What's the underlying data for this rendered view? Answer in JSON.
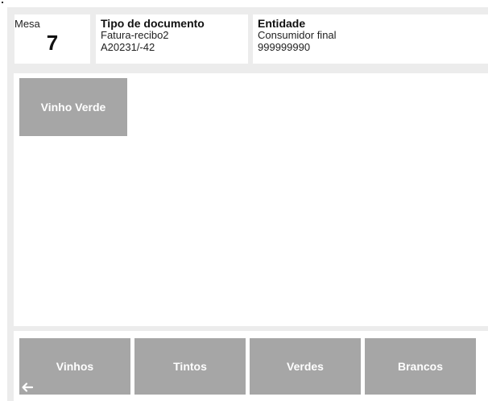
{
  "header": {
    "mesa_label": "Mesa",
    "mesa_value": "7",
    "document": {
      "title": "Tipo de documento",
      "type": "Fatura-recibo2",
      "number": "A20231/-42"
    },
    "entity": {
      "title": "Entidade",
      "name": "Consumidor final",
      "nif": "999999990"
    }
  },
  "products": {
    "items": [
      {
        "label": "Vinho Verde"
      }
    ]
  },
  "categories": {
    "items": [
      {
        "label": "Vinhos"
      },
      {
        "label": "Tintos"
      },
      {
        "label": "Verdes"
      },
      {
        "label": "Brancos"
      }
    ],
    "back_icon": "arrow-left-icon"
  },
  "colors": {
    "background": "#ececec",
    "card": "#ffffff",
    "button": "#a6a6a6",
    "button_text": "#ffffff"
  }
}
